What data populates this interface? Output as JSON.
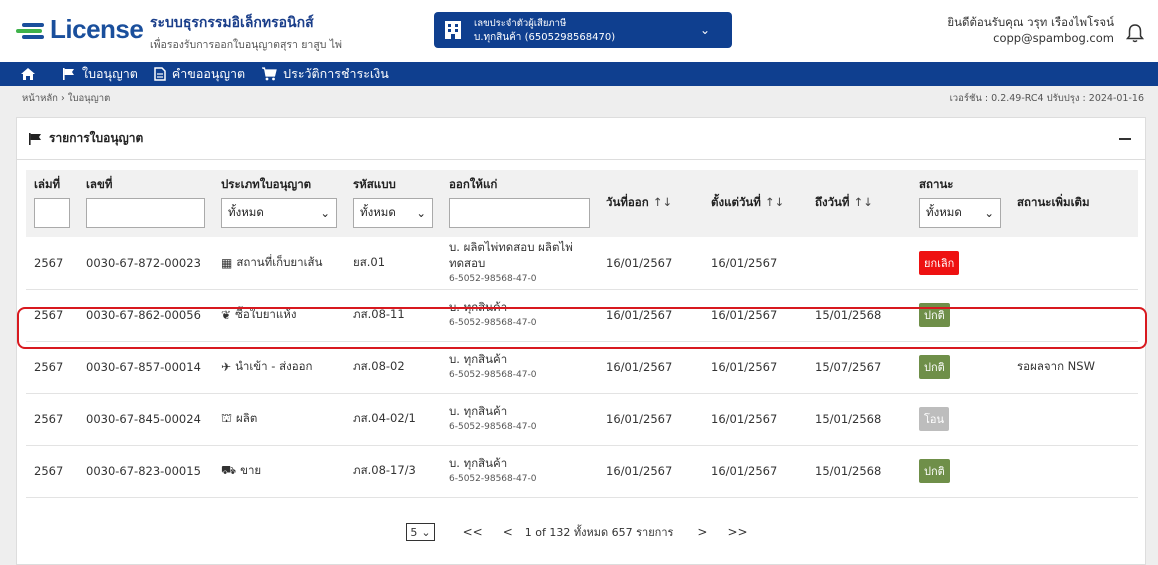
{
  "header": {
    "logo_text": "License",
    "title": "ระบบธุรกรรมอิเล็กทรอนิกส์",
    "subtitle": "เพื่อรองรับการออกใบอนุญาตสุรา ยาสูบ ไพ่",
    "taxpayer_label": "เลขประจำตัวผู้เสียภาษี",
    "taxpayer_value": "บ.ทุกสินค้า (6505298568470)",
    "welcome": "ยินดีต้อนรับคุณ วรุท เรืองไพโรจน์",
    "email": "copp@spambog.com"
  },
  "nav": {
    "items": [
      {
        "label": "ใบอนุญาต",
        "icon": "flag-icon"
      },
      {
        "label": "คำขออนุญาต",
        "icon": "document-icon"
      },
      {
        "label": "ประวัติการชำระเงิน",
        "icon": "cart-icon"
      }
    ]
  },
  "breadcrumb": {
    "home": "หน้าหลัก",
    "current": "ใบอนุญาต"
  },
  "version": "เวอร์ชัน : 0.2.49-RC4 ปรับปรุง : 2024-01-16",
  "card": {
    "title": "รายการใบอนุญาต",
    "columns": {
      "book": "เล่มที่",
      "number": "เลขที่",
      "type": "ประเภทใบอนุญาต",
      "form_code": "รหัสแบบ",
      "issued_to": "ออกให้แก่",
      "issue_date": "วันที่ออก",
      "from_date": "ตั้งแต่วันที่",
      "to_date": "ถึงวันที่",
      "status": "สถานะ",
      "extra_status": "สถานะเพิ่มเติม"
    },
    "filters": {
      "type": "ทั้งหมด",
      "form_code": "ทั้งหมด",
      "status": "ทั้งหมด"
    },
    "sort_icon": "↑↓",
    "rows": [
      {
        "book": "2567",
        "number": "0030-67-872-00023",
        "type_icon": "store-icon",
        "type_glyph": "▦",
        "type": "สถานที่เก็บยาเส้น",
        "form_code": "ยส.01",
        "issued_line1": "บ. ผลิตไพ่ทดสอบ ผลิตไพ่",
        "issued_line2": "ทดสอบ",
        "issued_sub": "6-5052-98568-47-0",
        "issue_date": "16/01/2567",
        "from_date": "16/01/2567",
        "to_date": "",
        "status": "ยกเลิก",
        "status_color": "#ee1111",
        "extra": ""
      },
      {
        "book": "2567",
        "number": "0030-67-862-00056",
        "type_icon": "leaf-icon",
        "type_glyph": "❦",
        "type": "ซื้อใบยาแห้ง",
        "form_code": "ภส.08-11",
        "issued_line1": "บ. ทุกสินค้า",
        "issued_line2": "",
        "issued_sub": "6-5052-98568-47-0",
        "issue_date": "16/01/2567",
        "from_date": "16/01/2567",
        "to_date": "15/01/2568",
        "status": "ปกติ",
        "status_color": "#6f8f49",
        "extra": ""
      },
      {
        "book": "2567",
        "number": "0030-67-857-00014",
        "type_icon": "plane-icon",
        "type_glyph": "✈",
        "type": "นำเข้า - ส่งออก",
        "form_code": "ภส.08-02",
        "issued_line1": "บ. ทุกสินค้า",
        "issued_line2": "",
        "issued_sub": "6-5052-98568-47-0",
        "issue_date": "16/01/2567",
        "from_date": "16/01/2567",
        "to_date": "15/07/2567",
        "status": "ปกติ",
        "status_color": "#6f8f49",
        "extra": "รอผลจาก NSW"
      },
      {
        "book": "2567",
        "number": "0030-67-845-00024",
        "type_icon": "factory-icon",
        "type_glyph": "⛫",
        "type": "ผลิต",
        "form_code": "ภส.04-02/1",
        "issued_line1": "บ. ทุกสินค้า",
        "issued_line2": "",
        "issued_sub": "6-5052-98568-47-0",
        "issue_date": "16/01/2567",
        "from_date": "16/01/2567",
        "to_date": "15/01/2568",
        "status": "โอน",
        "status_color": "#bdbdbd",
        "extra": ""
      },
      {
        "book": "2567",
        "number": "0030-67-823-00015",
        "type_icon": "basket-icon",
        "type_glyph": "⛟",
        "type": "ขาย",
        "form_code": "ภส.08-17/3",
        "issued_line1": "บ. ทุกสินค้า",
        "issued_line2": "",
        "issued_sub": "6-5052-98568-47-0",
        "issue_date": "16/01/2567",
        "from_date": "16/01/2567",
        "to_date": "15/01/2568",
        "status": "ปกติ",
        "status_color": "#6f8f49",
        "extra": ""
      }
    ]
  },
  "pagination": {
    "page_size": "5",
    "first": "<<",
    "prev": "<",
    "info": "1 of 132 ทั้งหมด 657 รายการ",
    "next": ">",
    "last": ">>"
  }
}
